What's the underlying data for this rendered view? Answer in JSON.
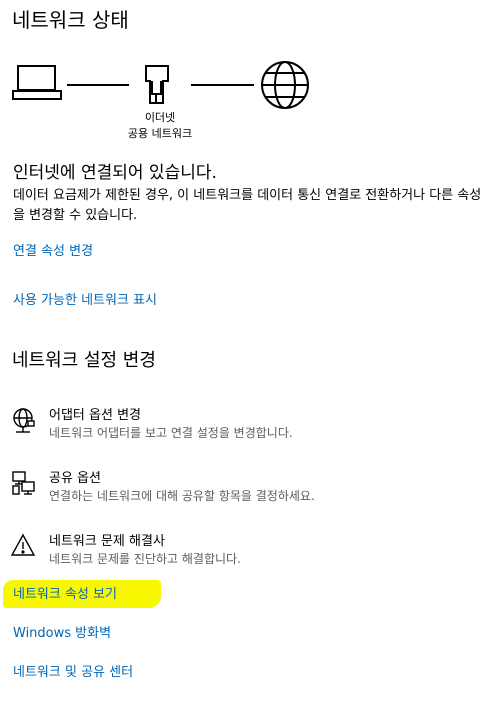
{
  "page": {
    "title": "네트워크 상태"
  },
  "diagram": {
    "connection_name": "이더넷",
    "connection_type": "공용 네트워크",
    "icons": [
      "laptop-icon",
      "ethernet-icon",
      "globe-icon"
    ]
  },
  "status": {
    "headline": "인터넷에 연결되어 있습니다.",
    "description": "데이터 요금제가 제한된 경우, 이 네트워크를 데이터 통신 연결로 전환하거나 다른 속성을 변경할 수 있습니다."
  },
  "links": {
    "change_connection_properties": "연결 속성 변경",
    "show_available_networks": "사용 가능한 네트워크 표시",
    "view_network_properties": "네트워크 속성 보기",
    "windows_firewall": "Windows 방화벽",
    "network_sharing_center": "네트워크 및 공유 센터"
  },
  "settings": {
    "section_title": "네트워크 설정 변경",
    "options": [
      {
        "title": "어댑터 옵션 변경",
        "description": "네트워크 어댑터를 보고 연결 설정을 변경합니다.",
        "icon": "adapter-globe-icon"
      },
      {
        "title": "공유 옵션",
        "description": "연결하는 네트워크에 대해 공유할 항목을 결정하세요.",
        "icon": "sharing-computers-icon"
      },
      {
        "title": "네트워크 문제 해결사",
        "description": "네트워크 문제를 진단하고 해결합니다.",
        "icon": "warning-icon"
      }
    ]
  },
  "colors": {
    "link": "#0067b8",
    "highlight": "#f7f700",
    "secondary_text": "#5d5d5d"
  }
}
